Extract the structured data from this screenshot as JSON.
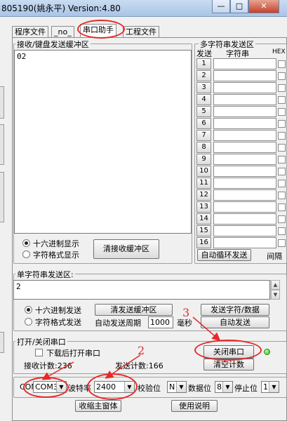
{
  "window": {
    "title": "805190(姚永平) Version:4.80"
  },
  "tabs": [
    {
      "label": "程序文件",
      "active": false
    },
    {
      "label": "_no_",
      "active": false
    },
    {
      "label": "串口助手",
      "active": true
    },
    {
      "label": "工程文件",
      "active": false
    }
  ],
  "receive": {
    "group_label": "接收/键盘发送缓冲区",
    "content": "02",
    "radio_hex": "十六进制显示",
    "radio_text": "字符格式显示",
    "clear_button": "清接收缓冲区"
  },
  "multi": {
    "group_label": "多字符串发送区",
    "col_send": "发送",
    "col_string": "字符串",
    "col_hex": "HEX",
    "rows": [
      "1",
      "2",
      "3",
      "4",
      "5",
      "6",
      "7",
      "8",
      "9",
      "10",
      "11",
      "12",
      "13",
      "14",
      "15",
      "16"
    ],
    "auto_loop_button": "自动循环发送",
    "interval_label": "间隔"
  },
  "single": {
    "group_label": "单字符串发送区:",
    "content": "2",
    "radio_hex": "十六进制发送",
    "radio_text": "字符格式发送",
    "clear_button": "清发送缓冲区",
    "send_button": "发送字符/数据",
    "auto_period_label": "自动发送周期",
    "period_value": "1000",
    "period_unit": "毫秒",
    "auto_send_button": "自动发送"
  },
  "port": {
    "group_label": "打开/关闭串口",
    "auto_open_label": "下载后打开串口",
    "close_button": "关闭串口",
    "clear_count_button": "清空计数",
    "rx_count_label": "接收计数:236",
    "tx_count_label": "发送计数:166",
    "led_color": "#2fbe19"
  },
  "settings": {
    "com_label": "COM",
    "com_value": "COM3",
    "baud_label": "波特率",
    "baud_value": "2400",
    "parity_label": "校验位",
    "parity_value": "N",
    "databits_label": "数据位",
    "databits_value": "8",
    "stopbits_label": "停止位",
    "stopbits_value": "1"
  },
  "bottom": {
    "shrink_button": "收缩主窗体",
    "help_button": "使用说明"
  },
  "annotations": {
    "num2": "2",
    "num3": "3",
    "color": "#e52a2a"
  }
}
